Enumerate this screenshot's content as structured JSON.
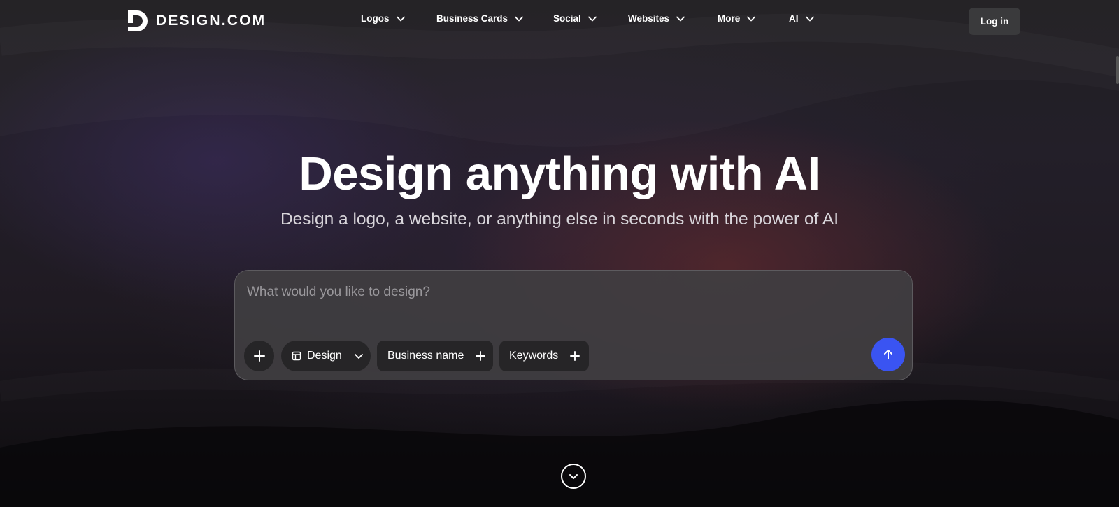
{
  "brand": {
    "name": "DESIGN.COM"
  },
  "nav": {
    "items": [
      {
        "label": "Logos"
      },
      {
        "label": "Business Cards"
      },
      {
        "label": "Social"
      },
      {
        "label": "Websites"
      },
      {
        "label": "More"
      },
      {
        "label": "AI"
      }
    ],
    "login_label": "Log in"
  },
  "hero": {
    "title": "Design anything with AI",
    "subtitle": "Design a logo, a website, or anything else in seconds with the power of AI"
  },
  "prompt": {
    "placeholder": "What would you like to design?",
    "chips": {
      "design_label": "Design",
      "business_name_label": "Business name",
      "keywords_label": "Keywords"
    }
  },
  "colors": {
    "accent": "#3a54f2",
    "login_bg": "#3a3a3c",
    "chip_bg": "#262527"
  },
  "icons": {
    "add": "plus-icon",
    "design": "layout-icon",
    "chevron": "chevron-down-icon",
    "send": "arrow-up-icon",
    "scroll": "chevron-circle-down-icon"
  }
}
